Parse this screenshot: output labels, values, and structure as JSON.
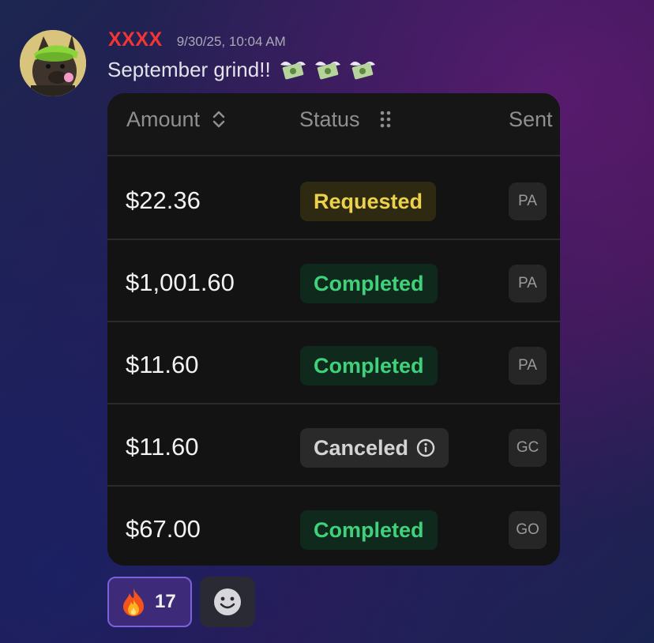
{
  "message": {
    "username": "XXXX",
    "timestamp": "9/30/25, 10:04 AM",
    "text": "September grind!!",
    "emojis": [
      "money-with-wings",
      "money-with-wings",
      "money-with-wings"
    ]
  },
  "table": {
    "headers": {
      "amount": "Amount",
      "status": "Status",
      "sent": "Sent"
    },
    "rows": [
      {
        "amount": "$22.36",
        "status": "Requested",
        "status_kind": "requested",
        "chip": "PA"
      },
      {
        "amount": "$1,001.60",
        "status": "Completed",
        "status_kind": "completed",
        "chip": "PA"
      },
      {
        "amount": "$11.60",
        "status": "Completed",
        "status_kind": "completed",
        "chip": "PA"
      },
      {
        "amount": "$11.60",
        "status": "Canceled",
        "status_kind": "canceled",
        "chip": "GC"
      },
      {
        "amount": "$67.00",
        "status": "Completed",
        "status_kind": "completed",
        "chip": "GO"
      }
    ]
  },
  "reactions": [
    {
      "emoji": "fire",
      "count": "17"
    }
  ],
  "colors": {
    "username": "#f23535",
    "requested": "#ecd14b",
    "completed": "#3fd27a",
    "canceled": "#d4d4d4",
    "reaction_border": "#7a62d8"
  }
}
